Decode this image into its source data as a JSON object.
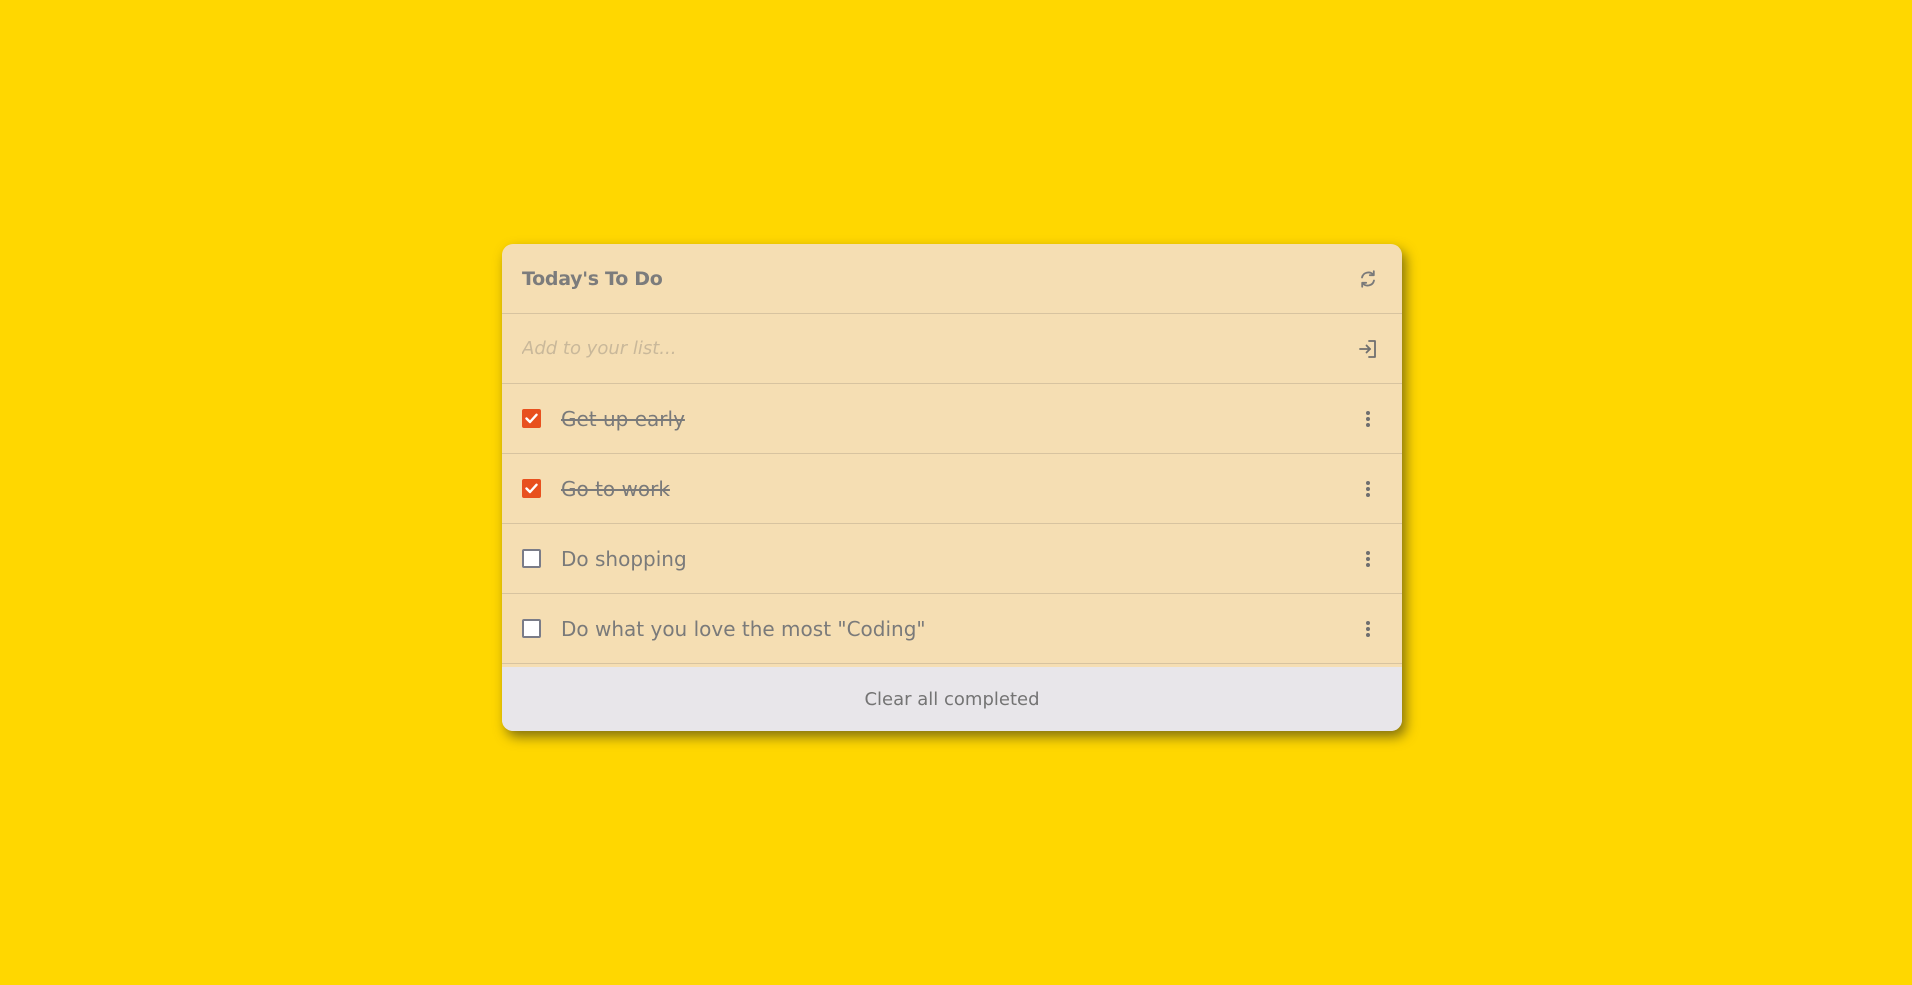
{
  "header": {
    "title": "Today's To Do",
    "refresh_icon": "refresh-icon"
  },
  "add": {
    "placeholder": "Add to your list...",
    "value": "",
    "submit_icon": "login-arrow-icon"
  },
  "tasks": [
    {
      "label": "Get up early",
      "completed": true
    },
    {
      "label": "Go to work",
      "completed": true
    },
    {
      "label": "Do shopping",
      "completed": false
    },
    {
      "label": "Do what you love the most \"Coding\"",
      "completed": false
    }
  ],
  "footer": {
    "clear_label": "Clear all completed"
  },
  "colors": {
    "background": "#FFD700",
    "card": "#F5DEB3",
    "checkbox_checked": "#E8501E",
    "footer": "#E8E6EA"
  }
}
